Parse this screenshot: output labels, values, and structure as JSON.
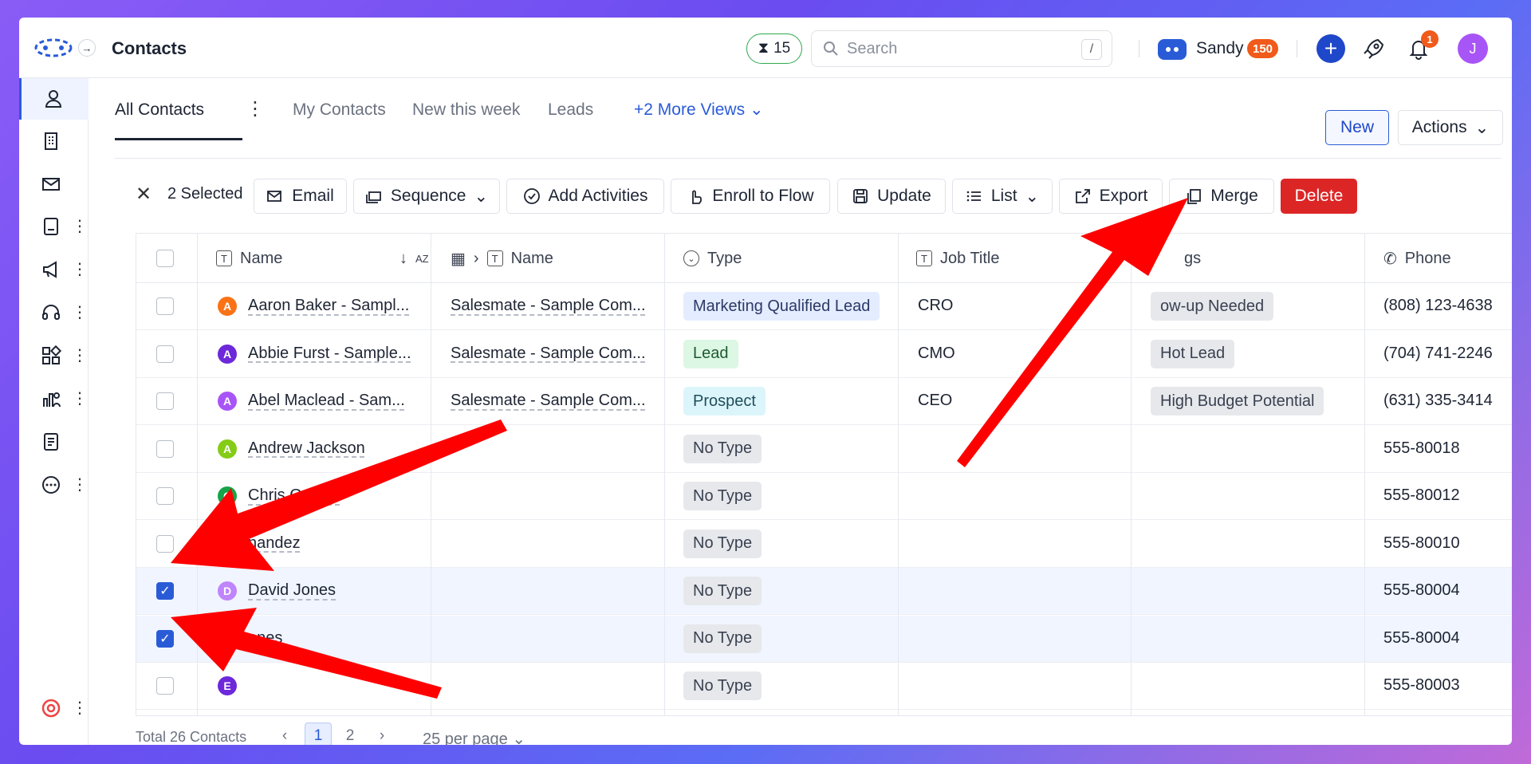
{
  "header": {
    "title": "Contacts",
    "timer_count": "15",
    "search_placeholder": "Search",
    "search_shortcut": "/",
    "user_name": "Sandy",
    "user_points": "150",
    "notification_count": "1",
    "profile_initial": "J"
  },
  "views": {
    "tabs": [
      "All Contacts",
      "My Contacts",
      "New this week",
      "Leads"
    ],
    "active": "All Contacts",
    "more_views": "+2 More Views",
    "new_label": "New",
    "actions_label": "Actions"
  },
  "selection": {
    "selected_label": "2 Selected",
    "buttons": {
      "email": "Email",
      "sequence": "Sequence",
      "add_activities": "Add Activities",
      "enroll": "Enroll to Flow",
      "update": "Update",
      "list": "List",
      "export": "Export",
      "merge": "Merge",
      "delete": "Delete"
    }
  },
  "table": {
    "columns": {
      "name": "Name",
      "company_name": "Name",
      "type": "Type",
      "job_title": "Job Title",
      "tags": "gs",
      "phone": "Phone"
    },
    "rows": [
      {
        "letter": "A",
        "letter_color": "#f97316",
        "name": "Aaron Baker - Sampl...",
        "company": "Salesmate - Sample Com...",
        "type": "Marketing Qualified Lead",
        "type_style": "mql",
        "job": "CRO",
        "tag": "ow-up Needed",
        "phone": "(808) 123-4638",
        "checked": false
      },
      {
        "letter": "A",
        "letter_color": "#6d28d9",
        "name": "Abbie Furst - Sample...",
        "company": "Salesmate - Sample Com...",
        "type": "Lead",
        "type_style": "lead",
        "job": "CMO",
        "tag": "Hot Lead",
        "phone": "(704) 741-2246",
        "checked": false
      },
      {
        "letter": "A",
        "letter_color": "#a855f7",
        "name": "Abel Maclead - Sam...",
        "company": "Salesmate - Sample Com...",
        "type": "Prospect",
        "type_style": "prospect",
        "job": "CEO",
        "tag": "High Budget Potential",
        "phone": "(631) 335-3414",
        "checked": false
      },
      {
        "letter": "A",
        "letter_color": "#84cc16",
        "name": "Andrew Jackson",
        "company": "",
        "type": "No Type",
        "type_style": "notype",
        "job": "",
        "tag": "",
        "phone": "555-80018",
        "checked": false
      },
      {
        "letter": "C",
        "letter_color": "#16a34a",
        "name": "Chris Gonzal",
        "company": "",
        "type": "No Type",
        "type_style": "notype",
        "job": "",
        "tag": "",
        "phone": "555-80012",
        "checked": false
      },
      {
        "letter": "",
        "letter_color": "#0ea5e9",
        "name": "nandez",
        "company": "",
        "type": "No Type",
        "type_style": "notype",
        "job": "",
        "tag": "",
        "phone": "555-80010",
        "checked": false
      },
      {
        "letter": "D",
        "letter_color": "#c084fc",
        "name": "David Jones",
        "company": "",
        "type": "No Type",
        "type_style": "notype",
        "job": "",
        "tag": "",
        "phone": "555-80004",
        "checked": true
      },
      {
        "letter": "",
        "letter_color": "#c084fc",
        "name": "ones",
        "company": "",
        "type": "No Type",
        "type_style": "notype",
        "job": "",
        "tag": "",
        "phone": "555-80004",
        "checked": true
      },
      {
        "letter": "E",
        "letter_color": "#6d28d9",
        "name": "",
        "company": "",
        "type": "No Type",
        "type_style": "notype",
        "job": "",
        "tag": "",
        "phone": "555-80003",
        "checked": false
      }
    ]
  },
  "footer": {
    "total": "Total 26 Contacts",
    "pages": [
      "1",
      "2"
    ],
    "current_page": "1",
    "per_page": "25 per page"
  },
  "colors": {
    "accent": "#2a5bd7",
    "delete": "#dc2626",
    "annotation_arrow": "#ff0000"
  }
}
